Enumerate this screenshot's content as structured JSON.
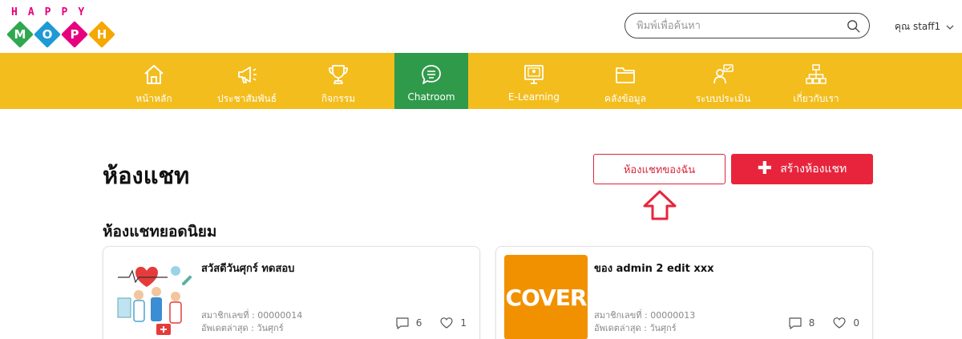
{
  "logo": {
    "top_letters": [
      "H",
      "A",
      "P",
      "P",
      "Y"
    ],
    "top_colors": [
      "#e6007e",
      "#e6007e",
      "#e6007e",
      "#e6007e",
      "#e6007e"
    ],
    "diamond_letters": [
      "M",
      "O",
      "P",
      "H"
    ],
    "diamond_colors": [
      "#2fa84f",
      "#1e9ad6",
      "#e6007e",
      "#f5a800"
    ]
  },
  "search": {
    "placeholder": "พิมพ์เพื่อค้นหา",
    "icon": "search-icon"
  },
  "user": {
    "label": "คุณ staff1",
    "icon": "chevron-down-icon"
  },
  "nav": {
    "background": "#f3bd1e",
    "active_color": "#2f9a4a",
    "items": [
      {
        "label": "หน้าหลัก",
        "icon": "home-icon"
      },
      {
        "label": "ประชาสัมพันธ์",
        "icon": "megaphone-icon"
      },
      {
        "label": "กิจกรรม",
        "icon": "trophy-icon"
      },
      {
        "label": "Chatroom",
        "icon": "chat-icon",
        "active": true
      },
      {
        "label": "E-Learning",
        "icon": "monitor-icon"
      },
      {
        "label": "คลังข้อมูล",
        "icon": "folder-icon"
      },
      {
        "label": "ระบบประเมิน",
        "icon": "evaluation-icon"
      },
      {
        "label": "เกี่ยวกับเรา",
        "icon": "org-chart-icon"
      }
    ]
  },
  "main": {
    "title": "ห้องแชท",
    "my_rooms_label": "ห้องแชทของฉัน",
    "create_label": "สร้างห้องแชท",
    "accent": "#e8243c",
    "popular_title": "ห้องแชทยอดนิยม",
    "rooms": [
      {
        "title": "สวัสดีวันศุกร์ ทดสอบ",
        "member_no": "สมาชิกเลขที่ : 00000014",
        "updated": "อัพเดตล่าสุด : วันศุกร์",
        "comments": "6",
        "likes": "1"
      },
      {
        "title": "ของ admin 2 edit xxx",
        "member_no": "สมาชิกเลขที่ : 00000013",
        "updated": "อัพเดตล่าสุด : วันศุกร์",
        "comments": "8",
        "likes": "0",
        "cover_text": "COVER"
      }
    ]
  }
}
